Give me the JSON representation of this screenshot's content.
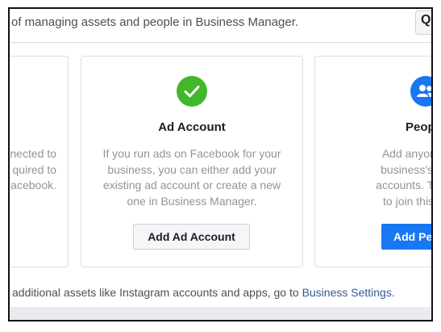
{
  "banner": {
    "text": "of managing assets and people in Business Manager.",
    "search_icon": "search-icon"
  },
  "cards": {
    "left": {
      "desc_lines": [
        "nected to",
        "quired to",
        "acebook."
      ]
    },
    "ad_account": {
      "icon": "check-icon",
      "icon_color": "#42b72a",
      "title": "Ad Account",
      "desc_lines": [
        "If you run ads on Facebook for your",
        "business, you can either add your",
        "existing ad account or create a new",
        "one in Business Manager."
      ],
      "button_label": "Add Ad Account"
    },
    "people": {
      "icon": "people-icon",
      "icon_color": "#1877f2",
      "title": "Peop",
      "desc_lines": [
        "Add anyone who",
        "business's Faceb",
        "accounts. They'll re",
        "to join this Busin"
      ],
      "button_label": "Add Pe"
    }
  },
  "footer": {
    "text_before": "additional assets like Instagram accounts and apps, go to ",
    "link_text": "Business Settings",
    "text_after": "."
  },
  "colors": {
    "primary_blue": "#1877f2",
    "link_blue": "#365899",
    "success_green": "#42b72a"
  }
}
